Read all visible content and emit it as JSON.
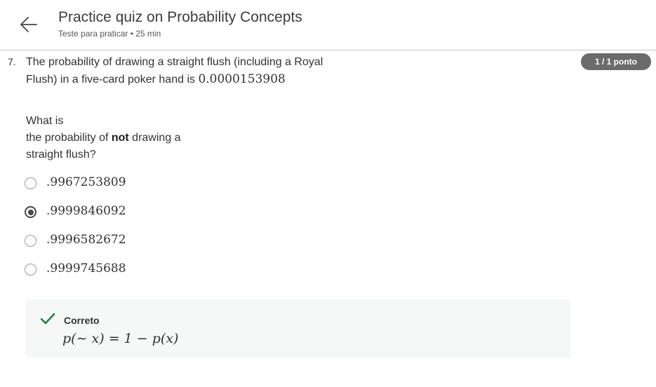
{
  "header": {
    "title": "Practice quiz on Probability Concepts",
    "subtitle": "Teste para praticar • 25 min"
  },
  "question": {
    "number": "7.",
    "text_before": "The probability of drawing a straight flush (including a Royal Flush) in a five-card poker hand is ",
    "value": "0.0000153908",
    "prompt_part1": "What is",
    "prompt_part2": "the probability of ",
    "prompt_bold": "not",
    "prompt_part3": " drawing a",
    "prompt_part4": "straight flush?",
    "score": "1 / 1 ponto"
  },
  "options": [
    {
      "label": ".9967253809",
      "selected": false
    },
    {
      "label": ".9999846092",
      "selected": true
    },
    {
      "label": ".9996582672",
      "selected": false
    },
    {
      "label": ".9999745688",
      "selected": false
    }
  ],
  "feedback": {
    "status": "Correto",
    "formula": "p(∼ x) = 1 − p(x)"
  },
  "colors": {
    "accent_check": "#1f7a4d",
    "badge_bg": "#6b6b6b",
    "feedback_bg": "#f5f8f7"
  }
}
